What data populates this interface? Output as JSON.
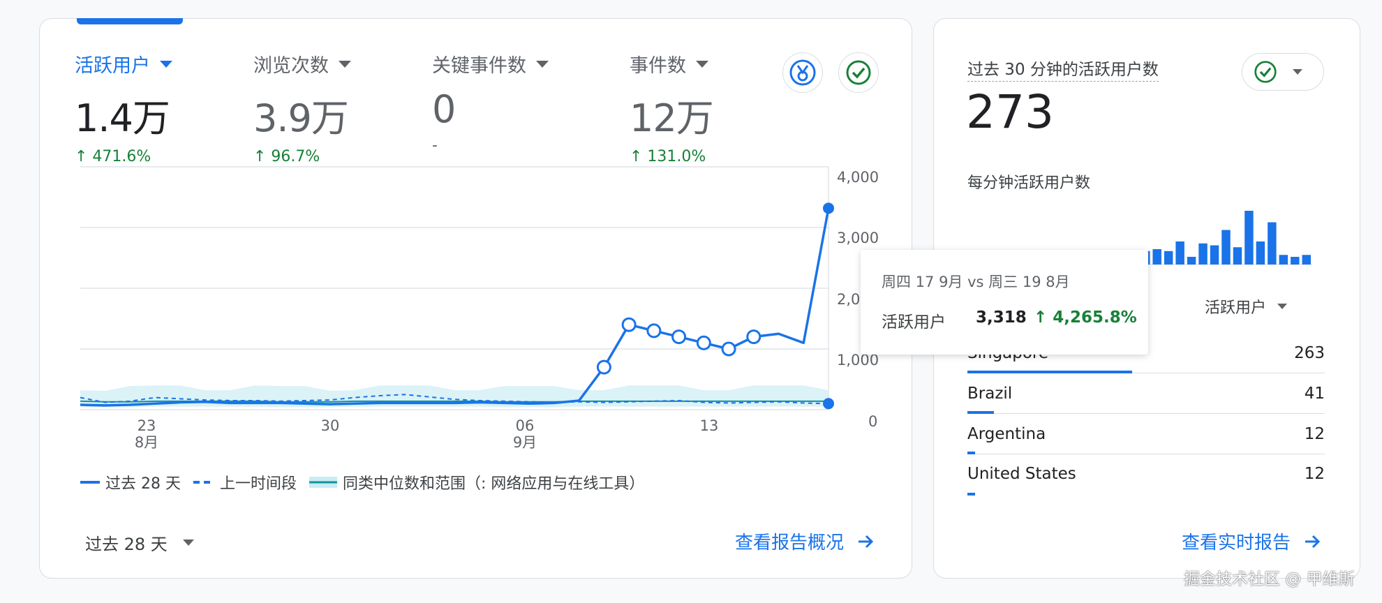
{
  "metrics": [
    {
      "label": "活跃用户",
      "value": "1.4万",
      "change": "↑ 471.6%"
    },
    {
      "label": "浏览次数",
      "value": "3.9万",
      "change": "↑ 96.7%"
    },
    {
      "label": "关键事件数",
      "value": "0",
      "change": "-"
    },
    {
      "label": "事件数",
      "value": "12万",
      "change": "↑ 131.0%"
    }
  ],
  "icons": {
    "insights": "medal-badge-icon",
    "status": "check-circle-icon"
  },
  "chart_data": {
    "type": "line",
    "x": [
      "08-20",
      "08-21",
      "08-22",
      "08-23",
      "08-24",
      "08-25",
      "08-26",
      "08-27",
      "08-28",
      "08-29",
      "08-30",
      "08-31",
      "09-01",
      "09-02",
      "09-03",
      "09-04",
      "09-05",
      "09-06",
      "09-07",
      "09-08",
      "09-09",
      "09-10",
      "09-11",
      "09-12",
      "09-13",
      "09-14",
      "09-15",
      "09-16",
      "09-17"
    ],
    "xtick_labels": [
      {
        "day": "23",
        "month": "8月",
        "x": "08-23"
      },
      {
        "day": "30",
        "month": "",
        "x": "08-30"
      },
      {
        "day": "06",
        "month": "9月",
        "x": "09-06"
      },
      {
        "day": "13",
        "month": "",
        "x": "09-13"
      }
    ],
    "yticks": [
      "4,000",
      "3,000",
      "2,000",
      "1,000",
      "0"
    ],
    "ylim": [
      0,
      4000
    ],
    "grid": true,
    "series": [
      {
        "name": "过去 28 天",
        "values": [
          80,
          70,
          80,
          100,
          120,
          130,
          110,
          110,
          110,
          100,
          90,
          100,
          110,
          110,
          110,
          110,
          120,
          110,
          100,
          110,
          150,
          700,
          1400,
          1300,
          1200,
          1100,
          1000,
          1200,
          1250,
          1100,
          3318
        ]
      },
      {
        "name": "上一时间段",
        "values": [
          200,
          120,
          140,
          200,
          180,
          160,
          150,
          150,
          140,
          150,
          160,
          200,
          230,
          250,
          210,
          170,
          150,
          140,
          130,
          120,
          130,
          120,
          130,
          140,
          150,
          120,
          110,
          120,
          130,
          110,
          100
        ]
      },
      {
        "name": "同类中位数和范围（: 网络应用与在线工具）",
        "values": [
          140,
          130,
          130,
          140,
          140,
          140,
          140,
          140,
          130,
          130,
          130,
          140,
          140,
          140,
          140,
          140,
          140,
          130,
          130,
          130,
          140,
          140,
          140,
          140,
          140,
          140,
          140,
          140,
          140,
          140,
          140
        ]
      }
    ],
    "legend_position": "bottom-left"
  },
  "range_select": "过去 28 天",
  "report_link": "查看报告概况",
  "realtime": {
    "title": "过去 30 分钟的活跃用户数",
    "value": "273",
    "subtitle": "每分钟活跃用户数",
    "per_minute": [
      0,
      0,
      0,
      0,
      0,
      1,
      2,
      3,
      3,
      4,
      4,
      4,
      4,
      5,
      6,
      7,
      8,
      7,
      12,
      4,
      11,
      10,
      18,
      9,
      28,
      12,
      22,
      5,
      4,
      5
    ],
    "column_label": "活跃用户",
    "rows": [
      {
        "name": "Singapore",
        "value": "263",
        "share": 0.46
      },
      {
        "name": "Brazil",
        "value": "41",
        "share": 0.074
      },
      {
        "name": "Argentina",
        "value": "12",
        "share": 0.022
      },
      {
        "name": "United States",
        "value": "12",
        "share": 0.022
      }
    ],
    "link": "查看实时报告"
  },
  "tooltip": {
    "date": "周四 17 9月 vs 周三 19 8月",
    "label": "活跃用户",
    "value": "3,318",
    "change": "↑ 4,265.8%"
  },
  "watermark": "掘金技术社区 @ 甲维斯",
  "colors": {
    "accent": "#1a73e8",
    "positive": "#188038",
    "band": "#d7f1f6"
  }
}
